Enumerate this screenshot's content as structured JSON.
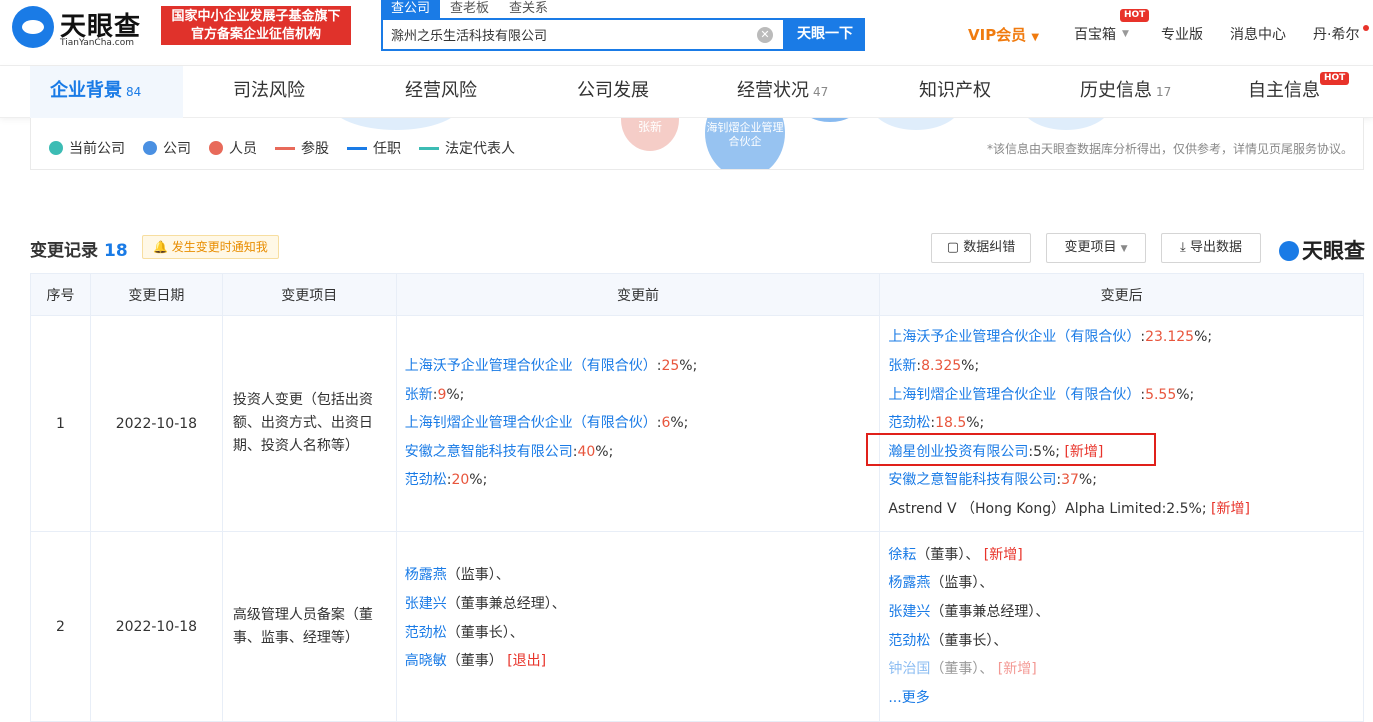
{
  "brand": {
    "name": "天眼查",
    "sub": "TianYanCha.com",
    "badge_line1": "国家中小企业发展子基金旗下",
    "badge_line2": "官方备案企业征信机构"
  },
  "search": {
    "tabs": [
      "查公司",
      "查老板",
      "查关系"
    ],
    "value": "滁州之乐生活科技有限公司",
    "button": "天眼一下"
  },
  "topnav": {
    "vip": "VIP会员",
    "baibaoxiang": "百宝箱",
    "hot": "HOT",
    "pro": "专业版",
    "messages": "消息中心",
    "user": "丹·希尔"
  },
  "tabs": [
    {
      "label": "企业背景",
      "count": "84"
    },
    {
      "label": "司法风险",
      "count": ""
    },
    {
      "label": "经营风险",
      "count": ""
    },
    {
      "label": "公司发展",
      "count": ""
    },
    {
      "label": "经营状况",
      "count": "47"
    },
    {
      "label": "知识产权",
      "count": ""
    },
    {
      "label": "历史信息",
      "count": "17"
    },
    {
      "label": "自主信息",
      "count": "",
      "hot": "HOT"
    }
  ],
  "graph_snippets": {
    "zhangxin": "张新",
    "node2a": "海钊熠企业管理",
    "node2b": "合伙企"
  },
  "legend": {
    "items": [
      "当前公司",
      "公司",
      "人员",
      "参股",
      "任职",
      "法定代表人"
    ],
    "note": "*该信息由天眼查数据库分析得出，仅供参考，详情见页尾服务协议。",
    "colors": {
      "current": "#3cbcb4",
      "company": "#4a90e2",
      "person": "#e86a5a",
      "share": "#e86a5a",
      "job": "#1a7be6",
      "legal": "#3cbcb4"
    }
  },
  "section": {
    "title": "变更记录",
    "count": "18",
    "notify": "发生变更时通知我",
    "btn_correct": "数据纠错",
    "btn_item": "变更项目",
    "btn_export": "导出数据",
    "brand": "天眼查"
  },
  "table": {
    "headers": [
      "序号",
      "变更日期",
      "变更项目",
      "变更前",
      "变更后"
    ],
    "rows": [
      {
        "idx": "1",
        "date": "2022-10-18",
        "item": "投资人变更（包括出资额、出资方式、出资日期、投资人名称等）",
        "before": [
          {
            "name": "上海沃予企业管理合伙企业（有限合伙）",
            "sep": ":",
            "pct": "25",
            "tail": "%;"
          },
          {
            "name": "张新",
            "sep": ":",
            "pct": "9",
            "tail": "%;"
          },
          {
            "name": "上海钊熠企业管理合伙企业（有限合伙）",
            "sep": ":",
            "pct": "6",
            "tail": "%;"
          },
          {
            "name": "安徽之意智能科技有限公司",
            "sep": ":",
            "pct": "40",
            "tail": "%;"
          },
          {
            "name": "范劲松",
            "sep": ":",
            "pct": "20",
            "tail": "%;"
          }
        ],
        "after": [
          {
            "name": "上海沃予企业管理合伙企业（有限合伙）",
            "sep": ":",
            "pct": "23.125",
            "tail": "%;",
            "tag": ""
          },
          {
            "name": "张新",
            "sep": ":",
            "pct": "8.325",
            "tail": "%;",
            "tag": ""
          },
          {
            "name": "上海钊熠企业管理合伙企业（有限合伙）",
            "sep": ":",
            "pct": "5.55",
            "tail": "%;",
            "tag": ""
          },
          {
            "name": "范劲松",
            "sep": ":",
            "pct": "18.5",
            "tail": "%;",
            "tag": ""
          },
          {
            "name": "瀚星创业投资有限公司",
            "sep": ":",
            "pct": "5",
            "tail": "%;",
            "tag": "[新增]"
          },
          {
            "name": "安徽之意智能科技有限公司",
            "sep": ":",
            "pct": "37",
            "tail": "%;",
            "tag": ""
          },
          {
            "plain": "Astrend V （Hong Kong）Alpha Limited:2.5%;",
            "tag": "[新增]"
          }
        ]
      },
      {
        "idx": "2",
        "date": "2022-10-18",
        "item": "高级管理人员备案（董事、监事、经理等）",
        "before": [
          {
            "name": "杨露燕",
            "role": "（监事）、",
            "tag": ""
          },
          {
            "name": "张建兴",
            "role": "（董事兼总经理）、",
            "tag": ""
          },
          {
            "name": "范劲松",
            "role": "（董事长）、",
            "tag": ""
          },
          {
            "name": "高晓敏",
            "role": "（董事）",
            "tag": "[退出]"
          }
        ],
        "after": [
          {
            "name": "徐耘",
            "role": "（董事）、",
            "tag": "[新增]"
          },
          {
            "name": "杨露燕",
            "role": "（监事）、",
            "tag": ""
          },
          {
            "name": "张建兴",
            "role": "（董事兼总经理）、",
            "tag": ""
          },
          {
            "name": "范劲松",
            "role": "（董事长）、",
            "tag": ""
          },
          {
            "name": "钟治国",
            "role": "（董事）、",
            "tag": "[新增]"
          }
        ],
        "more": "...更多"
      }
    ]
  }
}
